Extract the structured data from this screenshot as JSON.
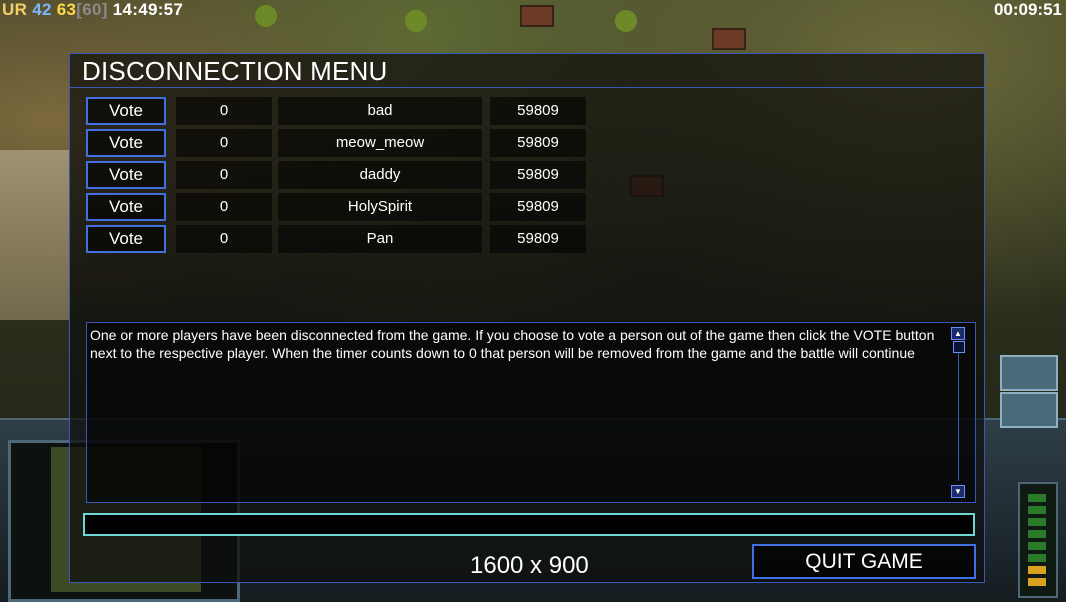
{
  "hud": {
    "faction": "UR",
    "stat_a": "42",
    "stat_b": "63",
    "stat_c": "[60]",
    "clock": "14:49:57",
    "game_timer": "00:09:51"
  },
  "menu": {
    "title": "DISCONNECTION MENU",
    "vote_label": "Vote",
    "players": [
      {
        "votes": "0",
        "name": "bad",
        "ping": "59809"
      },
      {
        "votes": "0",
        "name": "meow_meow",
        "ping": "59809"
      },
      {
        "votes": "0",
        "name": "daddy",
        "ping": "59809"
      },
      {
        "votes": "0",
        "name": "HolySpirit",
        "ping": "59809"
      },
      {
        "votes": "0",
        "name": "Pan",
        "ping": "59809"
      }
    ],
    "message": "One or more players have been disconnected from the game. If you choose to vote a person out of the game then click the VOTE button next to the respective player. When the timer counts down to 0 that person will be removed from the game and the battle will continue",
    "chat_value": "",
    "resolution": "1600 x 900",
    "quit_label": "QUIT GAME"
  },
  "icons": {
    "scroll_up": "triangle-up",
    "scroll_down": "triangle-down"
  },
  "colors": {
    "panel_border": "#3b55b8",
    "button_border": "#3f6fe0",
    "chat_border": "#6fd6d6"
  }
}
